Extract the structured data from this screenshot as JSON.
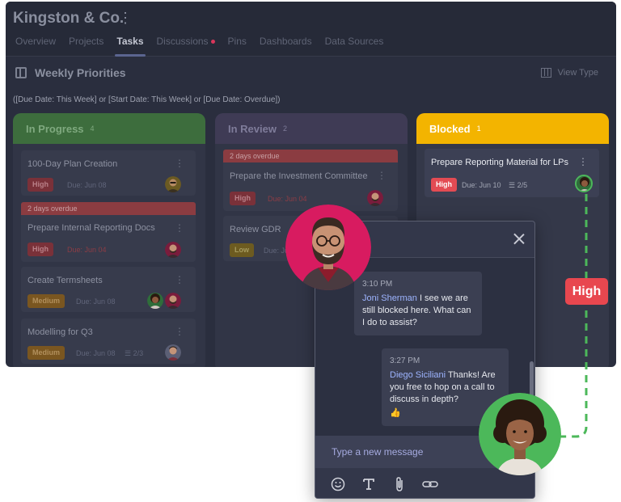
{
  "header": {
    "title": "Kingston & Co.",
    "tabs": [
      {
        "label": "Overview"
      },
      {
        "label": "Projects"
      },
      {
        "label": "Tasks"
      },
      {
        "label": "Discussions"
      },
      {
        "label": "Pins"
      },
      {
        "label": "Dashboards"
      },
      {
        "label": "Data Sources"
      }
    ],
    "active_tab": "Tasks"
  },
  "toolbar": {
    "board_title": "Weekly Priorities",
    "view_type_label": "View Type"
  },
  "filter_text": "([Due Date: This Week] or [Start Date: This Week] or [Due Date: Overdue])",
  "columns": [
    {
      "title": "In Progress",
      "count": "4",
      "color": "#3d6d3d",
      "cards": [
        {
          "title": "100-Day Plan Creation",
          "priority": "High",
          "due": "Due: Jun 08"
        },
        {
          "overdue": "2 days overdue",
          "title": "Prepare Internal Reporting Docs",
          "priority": "High",
          "due": "Due: Jun 04"
        },
        {
          "title": "Create Termsheets",
          "priority": "Medium",
          "due": "Due: Jun 08"
        },
        {
          "title": "Modelling for Q3",
          "priority": "Medium",
          "due": "Due: Jun 08",
          "subtasks": "2/3"
        }
      ]
    },
    {
      "title": "In Review",
      "count": "2",
      "color": "#3f3b55",
      "cards": [
        {
          "overdue": "2 days overdue",
          "title": "Prepare the Investment Committee",
          "priority": "High",
          "due": "Due: Jun 04"
        },
        {
          "title": "Review GDR",
          "priority": "Low",
          "due": "Due: Jun 08"
        }
      ]
    },
    {
      "title": "Blocked",
      "count": "1",
      "color": "#f3b400",
      "cards": [
        {
          "title": "Prepare Reporting Material for LPs",
          "priority": "High",
          "due": "Due: Jun 10",
          "subtasks": "2/5"
        }
      ]
    }
  ],
  "chat": {
    "messages": [
      {
        "time": "3:10 PM",
        "author": "Joni Sherman",
        "text": "I see we are still blocked here. What can I do to assist?"
      },
      {
        "time": "3:27 PM",
        "author": "Diego Siciliani",
        "text": "Thanks! Are you free to hop on a call to discuss in depth?",
        "emoji": "👍"
      }
    ],
    "input_placeholder": "Type a new message",
    "tools": [
      "emoji-icon",
      "text-format-icon",
      "attach-icon",
      "link-icon"
    ]
  },
  "floating_tag": "High",
  "colors": {
    "accent_green": "#4cb85a",
    "high_red": "#e8474f",
    "blocked_yellow": "#f3b400",
    "avatar_pink": "#d81b60"
  }
}
